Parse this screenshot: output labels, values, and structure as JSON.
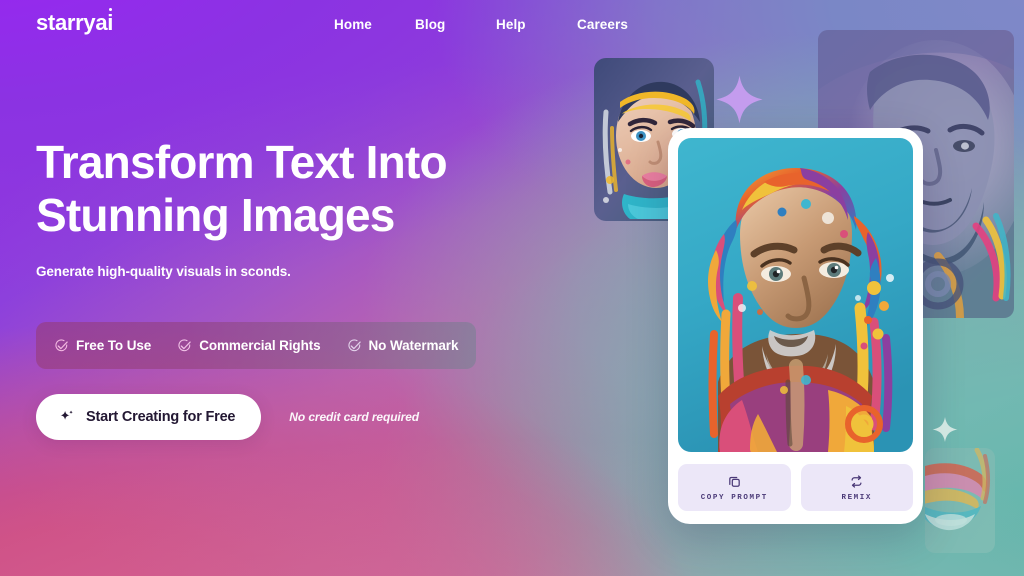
{
  "brand": {
    "logo_text": "starryai",
    "logo_accent_color": "#ffffff"
  },
  "nav": {
    "items": [
      {
        "label": "Home"
      },
      {
        "label": "Blog"
      },
      {
        "label": "Help"
      },
      {
        "label": "Careers"
      }
    ]
  },
  "hero": {
    "heading_line1": "Transform Text Into",
    "heading_line2": "Stunning Images",
    "subheading": "Generate high-quality visuals in sconds.",
    "features": [
      {
        "label": "Free To Use",
        "icon": "check-circle-icon"
      },
      {
        "label": "Commercial Rights",
        "icon": "check-circle-icon"
      },
      {
        "label": "No Watermark",
        "icon": "check-circle-icon"
      }
    ],
    "cta": {
      "label": "Start Creating for Free",
      "icon": "sparkle-icon",
      "note": "No credit card required"
    }
  },
  "showcase": {
    "card": {
      "image_alt": "colorful paint-splash portrait of a bearded man on teal background",
      "actions": [
        {
          "label": "COPY PROMPT",
          "icon": "copy-icon"
        },
        {
          "label": "REMIX",
          "icon": "repeat-icon"
        }
      ]
    },
    "thumbnails": [
      {
        "name": "woman-portrait",
        "image_alt": "woman face with colorful paint drips"
      },
      {
        "name": "statue-portrait",
        "image_alt": "bearded statue figure in purple and blue tones"
      },
      {
        "name": "corner-portrait",
        "image_alt": "faded colorful lips and paint swirl"
      }
    ],
    "decorations": [
      {
        "name": "sparkle-large",
        "icon": "sparkle-icon"
      },
      {
        "name": "sparkle-small",
        "icon": "sparkle-icon"
      }
    ]
  },
  "theme": {
    "purple": "#8b2fe0",
    "pink": "#cf4e85",
    "teal": "#6ab5ac",
    "blue": "#7b86c4",
    "cta_bg": "#ffffff",
    "cta_text": "#231833",
    "action_bg": "#ece7f8",
    "action_text": "#4b3a78"
  }
}
